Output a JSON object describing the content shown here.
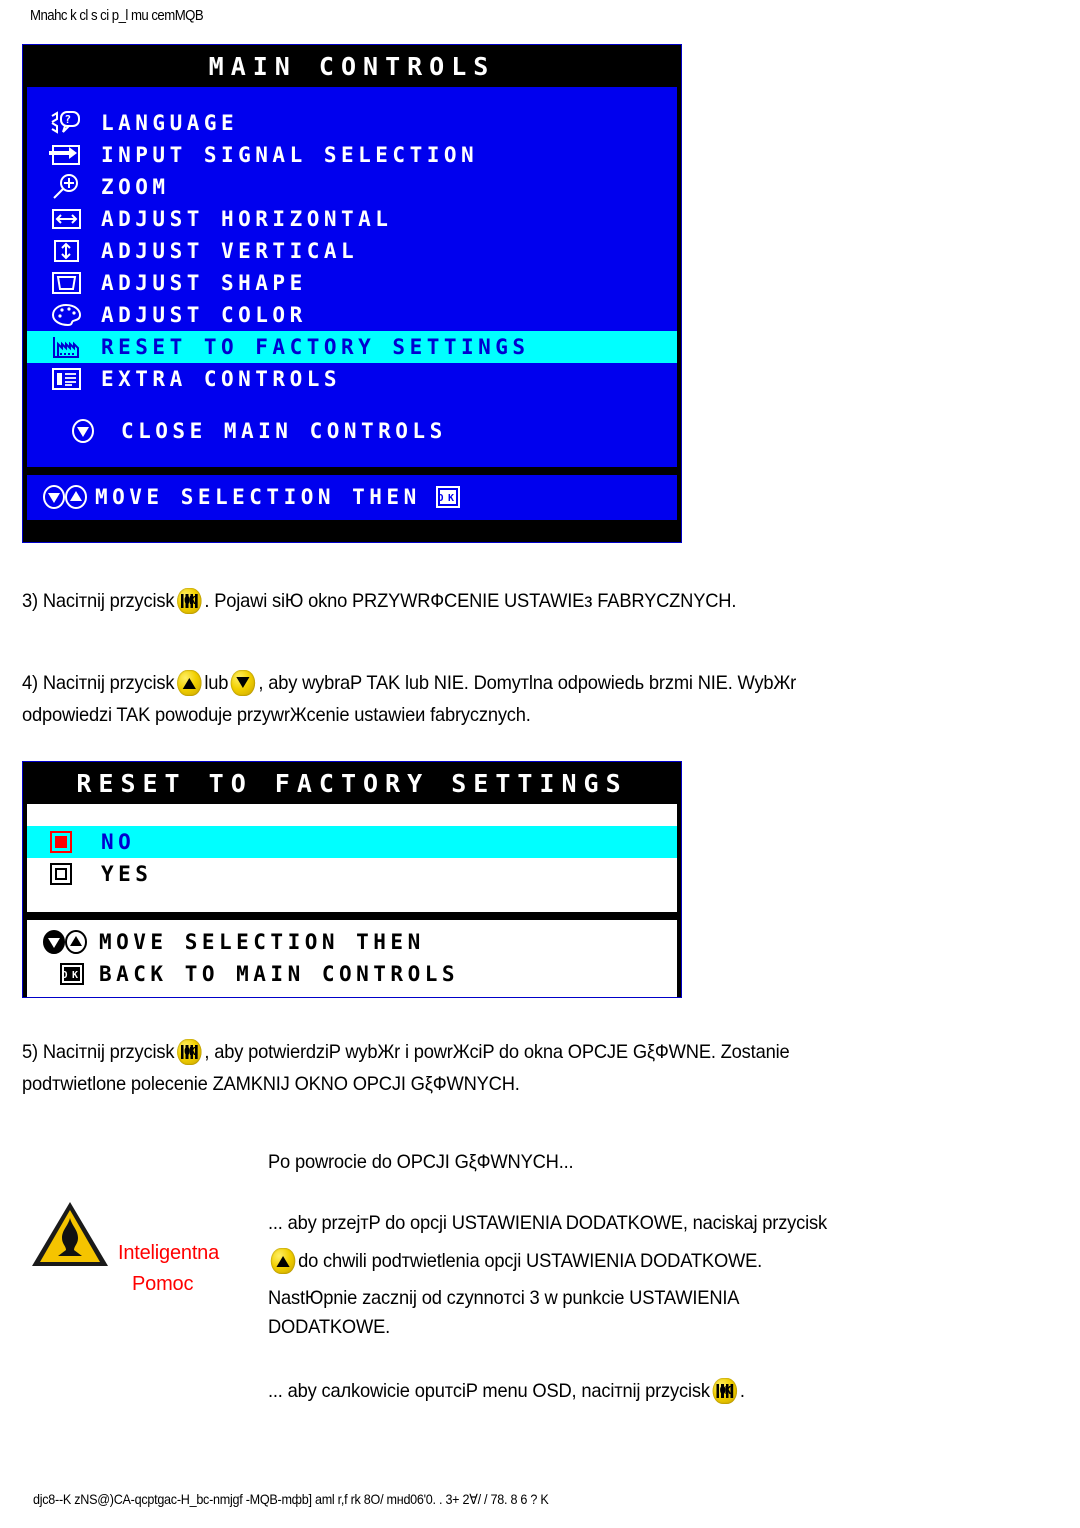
{
  "header": {
    "top_code": "Mnahc k cl s ci p_l mu cemMQB"
  },
  "osd_main": {
    "title": "MAIN CONTROLS",
    "items": [
      {
        "icon": "language-person-question-icon",
        "label": "LANGUAGE",
        "highlighted": false
      },
      {
        "icon": "input-signal-arrow-icon",
        "label": "INPUT SIGNAL SELECTION",
        "highlighted": false
      },
      {
        "icon": "zoom-magnifier-plus-icon",
        "label": "ZOOM",
        "highlighted": false
      },
      {
        "icon": "adjust-horizontal-icon",
        "label": "ADJUST HORIZONTAL",
        "highlighted": false
      },
      {
        "icon": "adjust-vertical-icon",
        "label": "ADJUST VERTICAL",
        "highlighted": false
      },
      {
        "icon": "adjust-shape-icon",
        "label": "ADJUST SHAPE",
        "highlighted": false
      },
      {
        "icon": "adjust-color-palette-icon",
        "label": "ADJUST COLOR",
        "highlighted": false
      },
      {
        "icon": "factory-reset-icon",
        "label": "RESET TO FACTORY SETTINGS",
        "highlighted": true
      },
      {
        "icon": "extra-controls-list-icon",
        "label": "EXTRA CONTROLS",
        "highlighted": false
      }
    ],
    "close_item": {
      "icon": "down-arrow-circle-icon",
      "label": "CLOSE MAIN CONTROLS"
    },
    "footer": {
      "icons": "down-up-arrow-circle-icons",
      "label": "MOVE SELECTION THEN",
      "ok_icon": "ok-button-icon"
    }
  },
  "osd_reset": {
    "title": "RESET TO FACTORY SETTINGS",
    "options": [
      {
        "icon": "radio-selected-red-icon",
        "label": "NO",
        "highlighted": true
      },
      {
        "icon": "radio-unselected-icon",
        "label": "YES",
        "highlighted": false
      }
    ],
    "footer_line1": {
      "icons": "down-up-arrow-circle-icons",
      "label": "MOVE SELECTION THEN"
    },
    "footer_line2": {
      "icon": "ok-button-icon",
      "label": "BACK TO MAIN CONTROLS"
    }
  },
  "steps": {
    "step3_a": "3) Naciтnij przycisk",
    "step3_b": ". Pojawi siЮ okno PRZYWRФCENIE USTAWIEз FABRYCZNYCH.",
    "step4_a": "4) Naciтnij przycisk",
    "step4_b": "lub",
    "step4_c": ", aby wybraP TAK lub NIE. Domyтlna odpowiedь brzmi NIE. WybЖr",
    "step4_d": "odpowiedzi TAK powoduje przywrЖcenie ustawieи fabrycznych.",
    "step5_a": "5) Naciтnij przycisk",
    "step5_b": ", aby potwierdziP wybЖr i powrЖciP do okna OPCJE GξФWNE. Zostanie",
    "step5_c": "podтwietlone polecenie ZAMKNIJ OKNO OPCJI GξФWNYCH."
  },
  "help": {
    "icon": "warning-triangle-icon",
    "label_line1": "Inteligentna",
    "label_line2": "Pomoc",
    "intro": "Po powrocie do OPCJI GξФWNYCH...",
    "body_line1": "... aby przejтP do opcji USTAWIENIA DODATKOWE, naciskaj przycisk",
    "body_line2": "do chwili podтwietlenia opcji USTAWIENIA DODATKOWE.",
    "body_line3": "NastЮpnie zacznij od czynnoтci 3 w punkcie USTAWIENIA",
    "body_line4": "DODATKOWE.",
    "exit_line": "... aby caлkowicie opuтciP menu OSD, naciтnij przycisk",
    "exit_tail": "."
  },
  "footer": {
    "code": "djc8--K zNS@)CA-qcptgac-H_bc-nmjgf -MQB-mфb] aml r,f rk  8O/ mнd06'0. . 3+ 2∀/ / 78. 8 6 ? K"
  },
  "colors": {
    "osd_blue": "#0000ee",
    "osd_highlight_cyan": "#00ffff",
    "osd_black": "#000000",
    "osd_white": "#ffffff",
    "button_yellow": "#f2d000",
    "help_red": "#ff0000",
    "radio_red": "#ff0000"
  }
}
